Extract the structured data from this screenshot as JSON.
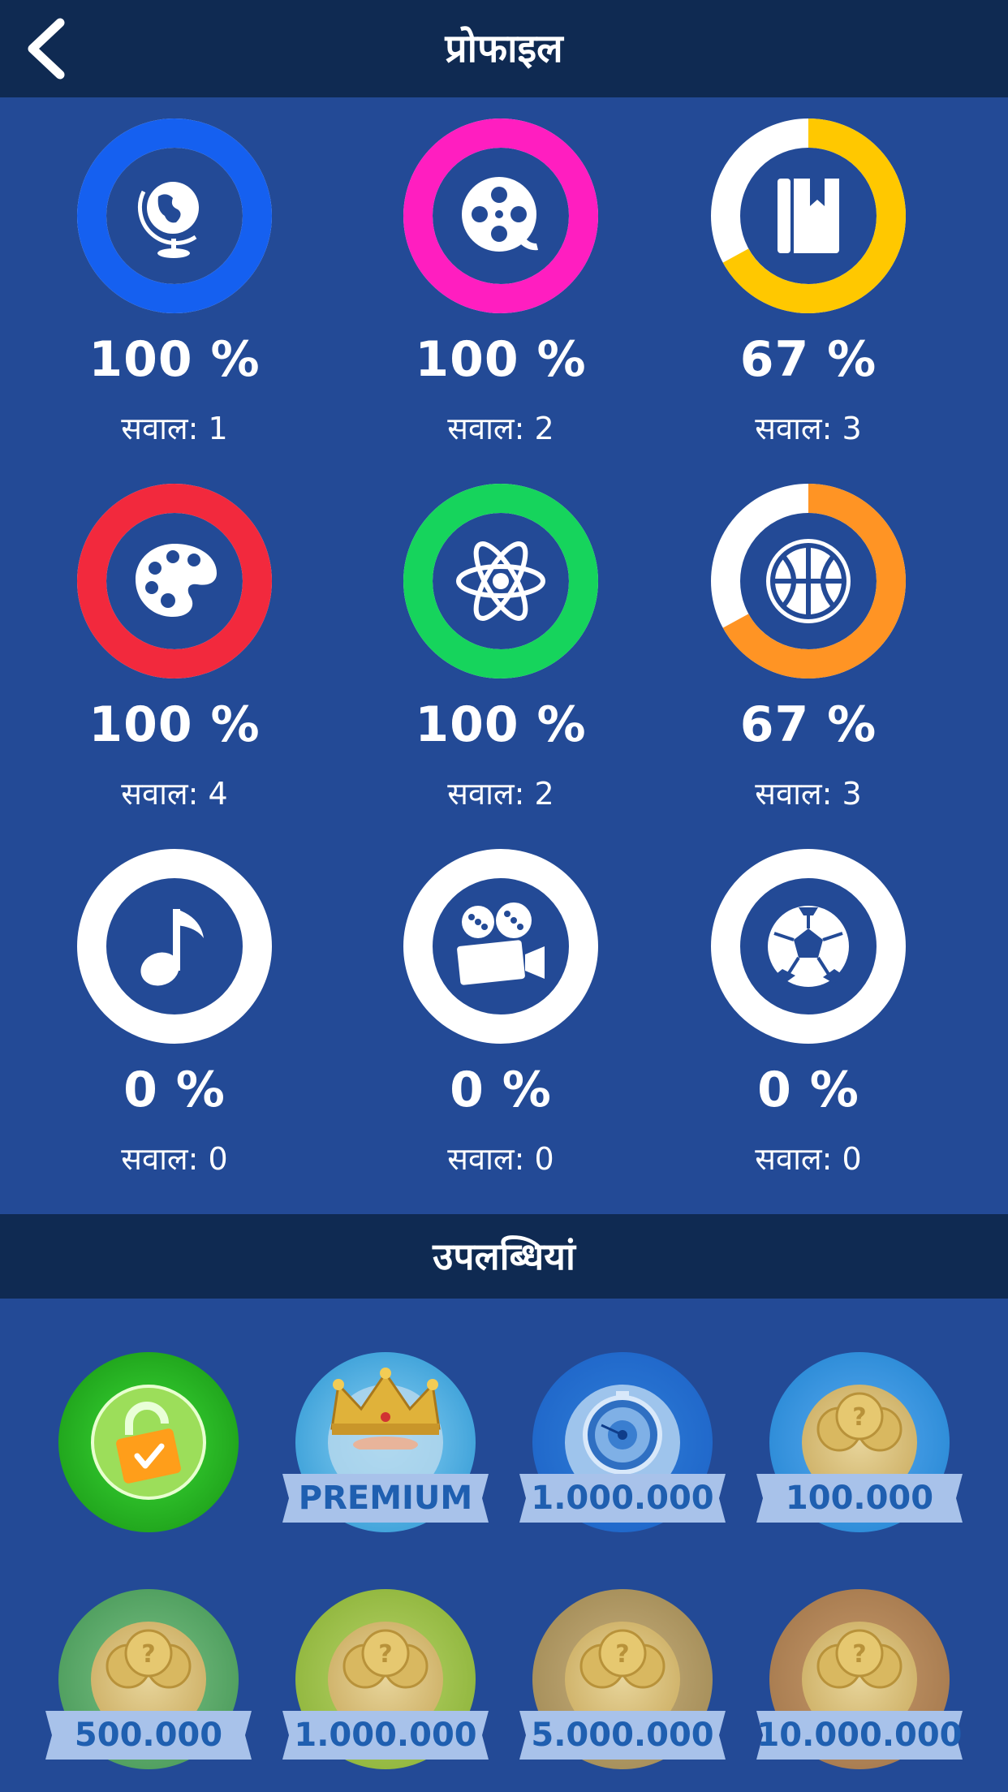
{
  "header": {
    "title": "प्रोफाइल",
    "back_icon": "chevron-left-icon"
  },
  "categories": [
    {
      "icon": "globe-icon",
      "color": "#1560f0",
      "progress": 1.0,
      "percent_label": "100 %",
      "questions_label": "सवाल: 1"
    },
    {
      "icon": "film-reel-icon",
      "color": "#ff1ec0",
      "progress": 1.0,
      "percent_label": "100 %",
      "questions_label": "सवाल: 2"
    },
    {
      "icon": "book-icon",
      "color": "#ffc800",
      "progress": 0.67,
      "percent_label": "67 %",
      "questions_label": "सवाल: 3"
    },
    {
      "icon": "palette-icon",
      "color": "#f2293d",
      "progress": 1.0,
      "percent_label": "100 %",
      "questions_label": "सवाल: 4"
    },
    {
      "icon": "atom-icon",
      "color": "#16d45c",
      "progress": 1.0,
      "percent_label": "100 %",
      "questions_label": "सवाल: 2"
    },
    {
      "icon": "basketball-icon",
      "color": "#ff9424",
      "progress": 0.67,
      "percent_label": "67 %",
      "questions_label": "सवाल: 3"
    },
    {
      "icon": "music-note-icon",
      "color": "#ffffff",
      "progress": 0.0,
      "percent_label": "0 %",
      "questions_label": "सवाल: 0"
    },
    {
      "icon": "movie-camera-icon",
      "color": "#ffffff",
      "progress": 0.0,
      "percent_label": "0 %",
      "questions_label": "सवाल: 0"
    },
    {
      "icon": "soccer-ball-icon",
      "color": "#ffffff",
      "progress": 0.0,
      "percent_label": "0 %",
      "questions_label": "सवाल: 0"
    }
  ],
  "achievements_section": {
    "title": "उपलब्धियां"
  },
  "achievements": [
    {
      "icon": "unlocked-padlock-icon",
      "label": "",
      "color": "#2db82a"
    },
    {
      "icon": "crown-icon",
      "label": "PREMIUM",
      "color": "#3a9fd8"
    },
    {
      "icon": "stopwatch-icon",
      "label": "1.000.000",
      "color": "#1f66c9"
    },
    {
      "icon": "coins-icon",
      "label": "100.000",
      "color": "#2a8ad6"
    },
    {
      "icon": "coins-icon",
      "label": "500.000",
      "color": "#4c9c5c"
    },
    {
      "icon": "coins-icon",
      "label": "1.000.000",
      "color": "#8fb53c"
    },
    {
      "icon": "coins-icon",
      "label": "5.000.000",
      "color": "#a48d58"
    },
    {
      "icon": "coins-icon",
      "label": "10.000.000",
      "color": "#a67a4e"
    }
  ]
}
